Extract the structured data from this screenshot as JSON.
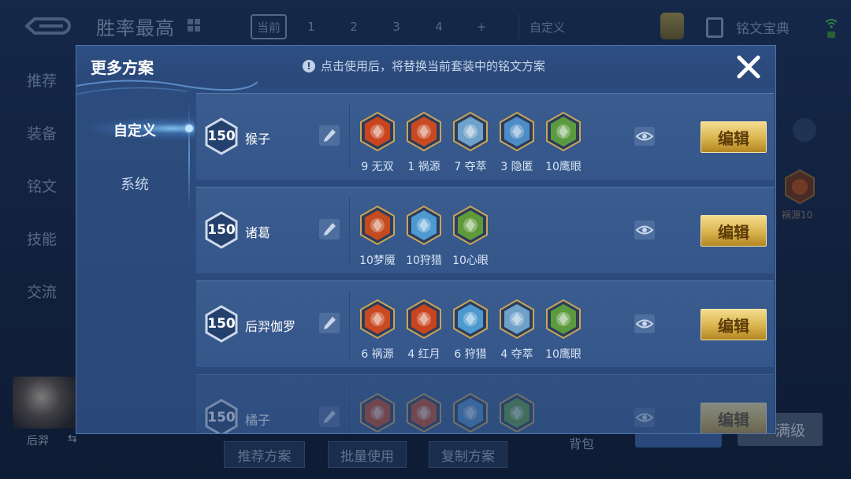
{
  "background": {
    "page_title": "胜率最高",
    "tabs": [
      {
        "label": "当前",
        "active": true
      },
      {
        "label": "1"
      },
      {
        "label": "2"
      },
      {
        "label": "3"
      },
      {
        "label": "4"
      },
      {
        "label": "+"
      },
      {
        "label": "自定义"
      }
    ],
    "rune_book_label": "铭文宝典",
    "left_nav": [
      "推荐",
      "装备",
      "铭文",
      "技能",
      "交流"
    ],
    "hero_name": "后羿",
    "swap_icon": "⇆",
    "bottom_buttons": [
      "推荐方案",
      "批量使用",
      "复制方案"
    ],
    "bag_label": "背包",
    "right_rune_label": "祸源10",
    "right_button_label": "满级"
  },
  "modal": {
    "title": "更多方案",
    "info_icon": "!",
    "info_text": "点击使用后，将替换当前套装中的铭文方案",
    "close_icon": "close-icon",
    "side_tabs": [
      {
        "label": "自定义",
        "active": true
      },
      {
        "label": "系统",
        "active": false
      }
    ],
    "edit_label": "编辑",
    "plans": [
      {
        "level": "150",
        "name": "猴子",
        "runes": [
          {
            "label": "9 无双",
            "color": "#c9451f",
            "icon": "blade-rune"
          },
          {
            "label": "1 祸源",
            "color": "#c94a22",
            "icon": "fan-rune"
          },
          {
            "label": "7 夺萃",
            "color": "#6fa1c9",
            "icon": "knot-rune"
          },
          {
            "label": "3 隐匿",
            "color": "#4d8cc7",
            "icon": "flame-rune"
          },
          {
            "label": "10鹰眼",
            "color": "#5b9a3e",
            "icon": "clover-rune"
          }
        ]
      },
      {
        "level": "150",
        "name": "诸葛",
        "runes": [
          {
            "label": "10梦魇",
            "color": "#c44a1f",
            "icon": "lotus-rune"
          },
          {
            "label": "10狩猎",
            "color": "#4e9ad0",
            "icon": "bolt-rune"
          },
          {
            "label": "10心眼",
            "color": "#5f9a3a",
            "icon": "shield-rune"
          }
        ]
      },
      {
        "level": "150",
        "name": "后羿伽罗",
        "runes": [
          {
            "label": "6 祸源",
            "color": "#c94a22",
            "icon": "fan-rune"
          },
          {
            "label": "4 红月",
            "color": "#c7441e",
            "icon": "moon-rune"
          },
          {
            "label": "6 狩猎",
            "color": "#4e9ad0",
            "icon": "bolt-rune"
          },
          {
            "label": "4 夺萃",
            "color": "#6fa1c9",
            "icon": "knot-rune"
          },
          {
            "label": "10鹰眼",
            "color": "#5b9a3e",
            "icon": "clover-rune"
          }
        ]
      },
      {
        "level": "150",
        "name": "橘子",
        "runes": [
          {
            "label": "",
            "color": "#c7441e",
            "icon": "moon-rune"
          },
          {
            "label": "",
            "color": "#c94a22",
            "icon": "fan-rune"
          },
          {
            "label": "",
            "color": "#4d8cc7",
            "icon": "flame-rune"
          },
          {
            "label": "",
            "color": "#5b9a3e",
            "icon": "clover-rune"
          }
        ]
      }
    ]
  }
}
